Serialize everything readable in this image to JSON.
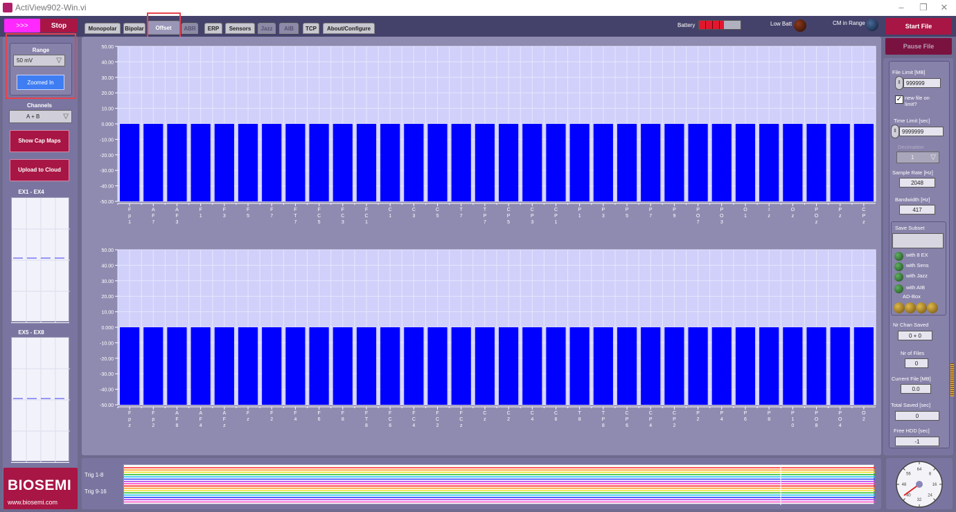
{
  "window": {
    "title": "ActiView902-Win.vi",
    "minimize": "–",
    "restore": "❐",
    "close": "✕"
  },
  "run_button": ">>>",
  "stop_button": "Stop",
  "tabs": [
    {
      "label": "Monopolar",
      "state": "normal"
    },
    {
      "label": "Bipolar",
      "state": "normal"
    },
    {
      "label": "Offset",
      "state": "active"
    },
    {
      "label": "ABR",
      "state": "dim"
    },
    {
      "label": "ERP",
      "state": "normal"
    },
    {
      "label": "Sensors",
      "state": "normal"
    },
    {
      "label": "Jazz",
      "state": "dim"
    },
    {
      "label": "AIB",
      "state": "dim"
    },
    {
      "label": "TCP",
      "state": "normal"
    },
    {
      "label": "About/Configure",
      "state": "normal"
    }
  ],
  "status": {
    "battery_label": "Battery",
    "battery_level": 0.6,
    "lowbatt_label": "Low Batt",
    "cm_label": "CM in Range"
  },
  "left": {
    "range_label": "Range",
    "range_value": "50 mV",
    "zoom_button": "Zoomed In",
    "channels_label": "Channels",
    "channels_value": "A + B",
    "show_cap_maps": "Show Cap Maps",
    "upload_cloud": "Upload to Cloud",
    "ex14_label": "EX1 - EX4",
    "ex58_label": "EX5 - EX8"
  },
  "logo": {
    "brand": "BIOSEMI",
    "url": "www.biosemi.com"
  },
  "right": {
    "start_file": "Start File",
    "pause_file": "Pause File",
    "file_limit_label": "File Limit [MB]",
    "file_limit_value": "999999",
    "new_file_label": "new file on limit?",
    "new_file_checked": true,
    "time_limit_label": "Time Limit [sec]",
    "time_limit_value": "9999999",
    "decimation_label": "Decimation",
    "decimation_value": "1",
    "sample_rate_label": "Sample Rate [Hz]",
    "sample_rate_value": "2048",
    "bandwidth_label": "Bandwidth [Hz]",
    "bandwidth_value": "417",
    "save_subset_label": "Save Subset",
    "save_subset_value": "",
    "with_8ex": "with 8 EX",
    "with_sens": "with Sens",
    "with_jazz": "with Jazz",
    "with_aib": "with AIB",
    "adbox": "AD-Box",
    "nr_chan_saved_label": "Nr Chan Saved",
    "nr_chan_saved_value": "0 + 0",
    "nr_files_label": "Nr of Files",
    "nr_files_value": "0",
    "current_file_label": "Current File [MB]",
    "current_file_value": "0.0",
    "total_saved_label": "Total Saved [sec]",
    "total_saved_value": "0",
    "free_hdd_label": "Free HDD [sec]",
    "free_hdd_value": "-1"
  },
  "trig": {
    "label1": "Trig 1-8",
    "label2": "Trig 9-16"
  },
  "speed_dial": {
    "ticks": [
      "64",
      "8",
      "16",
      "24",
      "32",
      "40",
      "48",
      "56"
    ]
  },
  "chart_data": [
    {
      "type": "bar",
      "name": "offset-chart-top",
      "ylim": [
        -50,
        50
      ],
      "yticks": [
        "50.00",
        "40.00",
        "30.00",
        "20.00",
        "10.00",
        "0.000",
        "-10.00",
        "-20.00",
        "-30.00",
        "-40.00",
        "-50.00"
      ],
      "categories": [
        "Fp1",
        "AF7",
        "AF3",
        "F1",
        "F3",
        "F5",
        "F7",
        "FT7",
        "FC5",
        "FC3",
        "FC1",
        "C1",
        "C3",
        "C5",
        "T7",
        "TP7",
        "CP5",
        "CP3",
        "CP1",
        "P1",
        "P3",
        "P5",
        "P7",
        "P9",
        "PO7",
        "PO3",
        "O1",
        "Iz",
        "Oz",
        "POz",
        "Pz",
        "CPz"
      ],
      "values": [
        -50,
        -50,
        -50,
        -50,
        -50,
        -50,
        -50,
        -50,
        -50,
        -50,
        -50,
        -50,
        -50,
        -50,
        -50,
        -50,
        -50,
        -50,
        -50,
        -50,
        -50,
        -50,
        -50,
        -50,
        -50,
        -50,
        -50,
        -50,
        -50,
        -50,
        -50,
        -50
      ],
      "grid": true
    },
    {
      "type": "bar",
      "name": "offset-chart-bottom",
      "ylim": [
        -50,
        50
      ],
      "yticks": [
        "50.00",
        "40.00",
        "30.00",
        "20.00",
        "10.00",
        "0.000",
        "-10.00",
        "-20.00",
        "-30.00",
        "-40.00",
        "-50.00"
      ],
      "categories": [
        "Fpz",
        "Fp2",
        "AF8",
        "AF4",
        "AFz",
        "Fz",
        "F2",
        "F4",
        "F6",
        "F8",
        "FT8",
        "FC6",
        "FC4",
        "FC2",
        "FCz",
        "Cz",
        "C2",
        "C4",
        "C6",
        "T8",
        "TP8",
        "CP6",
        "CP4",
        "CP2",
        "P2",
        "P4",
        "P6",
        "P8",
        "P10",
        "PO8",
        "PO4",
        "O2"
      ],
      "values": [
        -50,
        -50,
        -50,
        -50,
        -50,
        -50,
        -50,
        -50,
        -50,
        -50,
        -50,
        -50,
        -50,
        -50,
        -50,
        -50,
        -50,
        -50,
        -50,
        -50,
        -50,
        -50,
        -50,
        -50,
        -50,
        -50,
        -50,
        -50,
        -50,
        -50,
        -50,
        -50
      ],
      "grid": true
    }
  ]
}
